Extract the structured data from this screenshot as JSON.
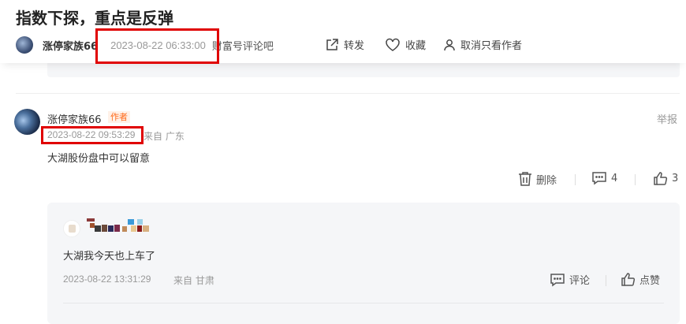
{
  "article": {
    "title": "指数下探，重点是反弹",
    "author": "涨停家族66",
    "time": "2023-08-22 06:33:00",
    "source": "财富号评论吧",
    "actions": {
      "share": "转发",
      "favorite": "收藏",
      "author_only": "取消只看作者"
    }
  },
  "comment": {
    "author": "涨停家族66",
    "badge": "作者",
    "report": "举报",
    "time": "2023-08-22 09:53:29",
    "location": "来自 广东",
    "text": "大湖股份盘中可以留意",
    "actions": {
      "delete": "删除",
      "comment_count": "4",
      "like_count": "3"
    }
  },
  "reply": {
    "text": "大湖我今天也上车了",
    "time": "2023-08-22 13:31:29",
    "location": "来自 甘肃",
    "actions": {
      "comment": "评论",
      "like": "点赞"
    }
  },
  "colors": {
    "highlight_box": "#e00000",
    "badge_text": "#ff6a1a",
    "reply_bg": "#f5f6f8"
  }
}
